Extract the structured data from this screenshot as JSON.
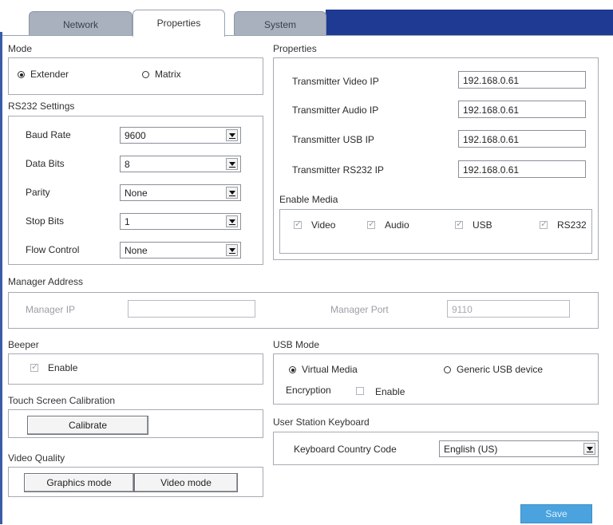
{
  "tabs": [
    {
      "label": "Network"
    },
    {
      "label": "Properties"
    },
    {
      "label": "System"
    }
  ],
  "mode": {
    "title": "Mode",
    "options": [
      {
        "label": "Extender",
        "selected": true
      },
      {
        "label": "Matrix",
        "selected": false
      }
    ]
  },
  "rs232": {
    "title": "RS232 Settings",
    "fields": [
      {
        "label": "Baud Rate",
        "value": "9600"
      },
      {
        "label": "Data Bits",
        "value": "8"
      },
      {
        "label": "Parity",
        "value": "None"
      },
      {
        "label": "Stop Bits",
        "value": "1"
      },
      {
        "label": "Flow Control",
        "value": "None"
      }
    ]
  },
  "properties": {
    "title": "Properties",
    "fields": [
      {
        "label": "Transmitter Video IP",
        "value": "192.168.0.61"
      },
      {
        "label": "Transmitter Audio IP",
        "value": "192.168.0.61"
      },
      {
        "label": "Transmitter USB IP",
        "value": "192.168.0.61"
      },
      {
        "label": "Transmitter RS232 IP",
        "value": "192.168.0.61"
      }
    ]
  },
  "enable_media": {
    "title": "Enable Media",
    "items": [
      {
        "label": "Video",
        "checked": true
      },
      {
        "label": "Audio",
        "checked": true
      },
      {
        "label": "USB",
        "checked": true
      },
      {
        "label": "RS232",
        "checked": true
      }
    ]
  },
  "manager": {
    "title": "Manager Address",
    "ip_label": "Manager IP",
    "ip_value": "",
    "port_label": "Manager Port",
    "port_value": "9110"
  },
  "beeper": {
    "title": "Beeper",
    "enable_label": "Enable",
    "enabled": true
  },
  "usb_mode": {
    "title": "USB Mode",
    "options": [
      {
        "label": "Virtual Media",
        "selected": true
      },
      {
        "label": "Generic USB device",
        "selected": false
      }
    ],
    "encryption_label": "Encryption",
    "encryption_enable_label": "Enable",
    "encryption_enabled": false
  },
  "touch": {
    "title": "Touch Screen Calibration",
    "button_label": "Calibrate"
  },
  "keyboard": {
    "title": "User Station Keyboard",
    "label": "Keyboard Country Code",
    "value": "English (US)"
  },
  "video_quality": {
    "title": "Video Quality",
    "buttons": [
      {
        "label": "Graphics mode"
      },
      {
        "label": "Video mode"
      }
    ]
  },
  "save_label": "Save",
  "colors": {
    "tab_bar": "#1f3a93",
    "save_button": "#4aa3df"
  }
}
